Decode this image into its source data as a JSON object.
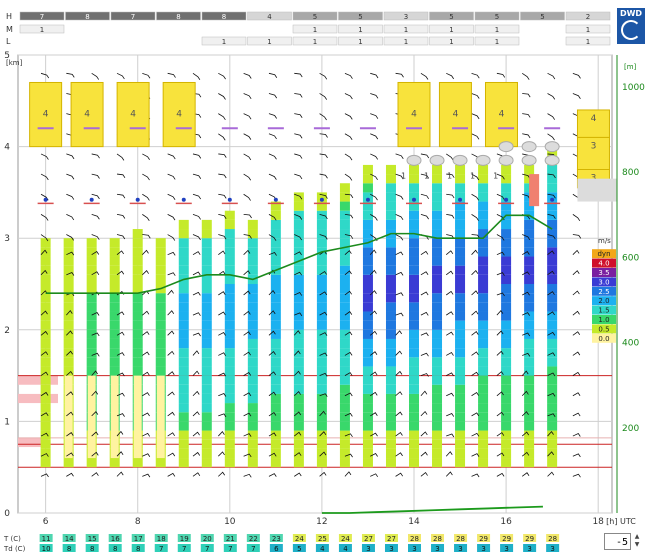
{
  "chart_data": {
    "type": "heatmap",
    "x_axis": {
      "ticks": [
        "6",
        "8",
        "10",
        "12",
        "14",
        "16",
        "18"
      ],
      "unit_label": "[h] UTC",
      "range": [
        5.4,
        18.3
      ]
    },
    "y_axis_left": {
      "ticks": [
        "0",
        "1",
        "2",
        "3",
        "4",
        "5"
      ],
      "unit_label": "[km]",
      "range": [
        0,
        5
      ]
    },
    "y_axis_right": {
      "ticks": [
        "200",
        "400",
        "600",
        "800",
        "1000"
      ],
      "unit_label": "[m]"
    },
    "cloud_rows": {
      "H": {
        "label": "H",
        "values": [
          "7",
          "8",
          "7",
          "8",
          "8",
          "4",
          "5",
          "5",
          "3",
          "5",
          "5",
          "5",
          "2"
        ]
      },
      "M": {
        "label": "M",
        "values": [
          "1",
          "",
          "",
          "",
          "",
          "",
          "1",
          "1",
          "1",
          "1",
          "1",
          "",
          "1"
        ]
      },
      "L": {
        "label": "L",
        "values": [
          "",
          "",
          "",
          "",
          "1",
          "1",
          "1",
          "1",
          "1",
          "1",
          "1",
          "",
          "1"
        ]
      }
    },
    "times": [
      6.0,
      6.5,
      7.0,
      7.5,
      8.0,
      8.5,
      9.0,
      9.5,
      10.0,
      10.5,
      11.0,
      11.5,
      12.0,
      12.5,
      13.0,
      13.5,
      14.0,
      14.5,
      15.0,
      15.5,
      16.0,
      16.5,
      17.0
    ],
    "column_tops_km": [
      3.0,
      3.0,
      3.0,
      3.0,
      3.1,
      3.0,
      3.2,
      3.2,
      3.3,
      3.2,
      3.4,
      3.5,
      3.5,
      3.6,
      3.8,
      3.8,
      3.8,
      3.8,
      3.8,
      3.8,
      3.8,
      3.8,
      4.0
    ],
    "column_bottom_km": 0.5,
    "boundary_layer_km": [
      2.4,
      2.4,
      2.4,
      2.4,
      2.4,
      2.45,
      2.55,
      2.6,
      2.6,
      2.55,
      2.65,
      2.75,
      2.85,
      2.9,
      2.95,
      3.05,
      3.05,
      3.0,
      3.0,
      3.0,
      3.25,
      3.25,
      3.1
    ],
    "surface_line_km": [
      0.0,
      0.0,
      0.01,
      0.02,
      0.03,
      0.04,
      0.05,
      0.06,
      0.07
    ],
    "high_cloud_boxes": [
      {
        "time": 6.0,
        "value": "4"
      },
      {
        "time": 6.9,
        "value": "4"
      },
      {
        "time": 7.9,
        "value": "4"
      },
      {
        "time": 8.9,
        "value": "4"
      },
      {
        "time": 14.0,
        "value": "4"
      },
      {
        "time": 14.9,
        "value": "4"
      },
      {
        "time": 15.9,
        "value": "4"
      }
    ],
    "right_side_boxes": [
      "4",
      "3",
      "3"
    ],
    "dots_count_labels": [
      "1",
      "1",
      "1",
      "1",
      "1"
    ],
    "legend": {
      "unit": "m/s",
      "items": [
        {
          "label": "dyn",
          "color": "#f2a818"
        },
        {
          "label": "4.0",
          "color": "#d0102a"
        },
        {
          "label": "3.5",
          "color": "#7a1fa0"
        },
        {
          "label": "3.0",
          "color": "#3a3bd4"
        },
        {
          "label": "2.5",
          "color": "#1f78e0"
        },
        {
          "label": "2.0",
          "color": "#1cb1f0"
        },
        {
          "label": "1.5",
          "color": "#2fd8c8"
        },
        {
          "label": "1.0",
          "color": "#39d86b"
        },
        {
          "label": "0.5",
          "color": "#c5ea2a"
        },
        {
          "label": "0.0",
          "color": "#fff3a0"
        }
      ]
    },
    "bottom_rows": {
      "T_label": "T  (C)",
      "Td_label": "Td (C)",
      "T": [
        "11",
        "14",
        "15",
        "16",
        "17",
        "18",
        "19",
        "20",
        "21",
        "22",
        "23",
        "24",
        "25",
        "24",
        "27",
        "27",
        "28",
        "28",
        "28",
        "29",
        "29",
        "29",
        "28"
      ],
      "Td": [
        "10",
        "8",
        "8",
        "8",
        "8",
        "7",
        "7",
        "7",
        "7",
        "7",
        "6",
        "5",
        "4",
        "4",
        "3",
        "3",
        "3",
        "3",
        "3",
        "3",
        "3",
        "3",
        "3"
      ]
    },
    "step_value": "-5"
  },
  "branding": {
    "logo_text": "DWD"
  }
}
